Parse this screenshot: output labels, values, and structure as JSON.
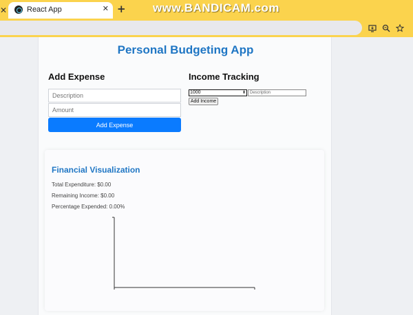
{
  "browser": {
    "tab_title": "React App",
    "watermark": "www.BANDICAM.com"
  },
  "app": {
    "title": "Personal Budgeting App"
  },
  "expense": {
    "heading": "Add Expense",
    "description_placeholder": "Description",
    "amount_placeholder": "Amount",
    "button_label": "Add Expense"
  },
  "income": {
    "heading": "Income Tracking",
    "amount_value": "1000",
    "description_placeholder": "Description",
    "button_label": "Add Income"
  },
  "visualization": {
    "heading": "Financial Visualization",
    "total_expenditure": "Total Expenditure: $0.00",
    "remaining_income": "Remaining Income: $0.00",
    "percentage_expended": "Percentage Expended: 0.00%"
  },
  "chart_data": {
    "type": "bar",
    "categories": [],
    "values": []
  },
  "colors": {
    "accent": "#1f76c4",
    "button": "#0a7bff",
    "browser_frame": "#fbd34d"
  }
}
